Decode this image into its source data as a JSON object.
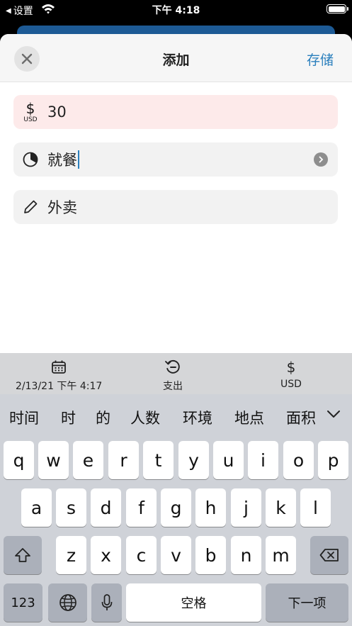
{
  "status_bar": {
    "back_label": "设置",
    "time": "下午 4:18"
  },
  "sheet": {
    "title": "添加",
    "save_label": "存储",
    "amount": {
      "currency_symbol": "$",
      "currency_code": "USD",
      "value": "30"
    },
    "category": {
      "value": "就餐",
      "icon": "pie-chart-icon"
    },
    "note": {
      "value": "外卖",
      "icon": "pencil-icon"
    }
  },
  "accessory": {
    "date": "2/13/21 下午 4:17",
    "type": "支出",
    "currency_symbol": "$",
    "currency": "USD"
  },
  "keyboard": {
    "candidates": [
      "时间",
      "时",
      "的",
      "人数",
      "环境",
      "地点",
      "面积"
    ],
    "row1": [
      "q",
      "w",
      "e",
      "r",
      "t",
      "y",
      "u",
      "i",
      "o",
      "p"
    ],
    "row2": [
      "a",
      "s",
      "d",
      "f",
      "g",
      "h",
      "j",
      "k",
      "l"
    ],
    "row3": [
      "z",
      "x",
      "c",
      "v",
      "b",
      "n",
      "m"
    ],
    "numbers_label": "123",
    "space_label": "空格",
    "next_label": "下一项"
  },
  "colors": {
    "accent": "#2a7fbd",
    "amount_bg": "#fdeaea",
    "field_bg": "#f2f2f2",
    "keyboard_bg": "#cfd2d8"
  }
}
